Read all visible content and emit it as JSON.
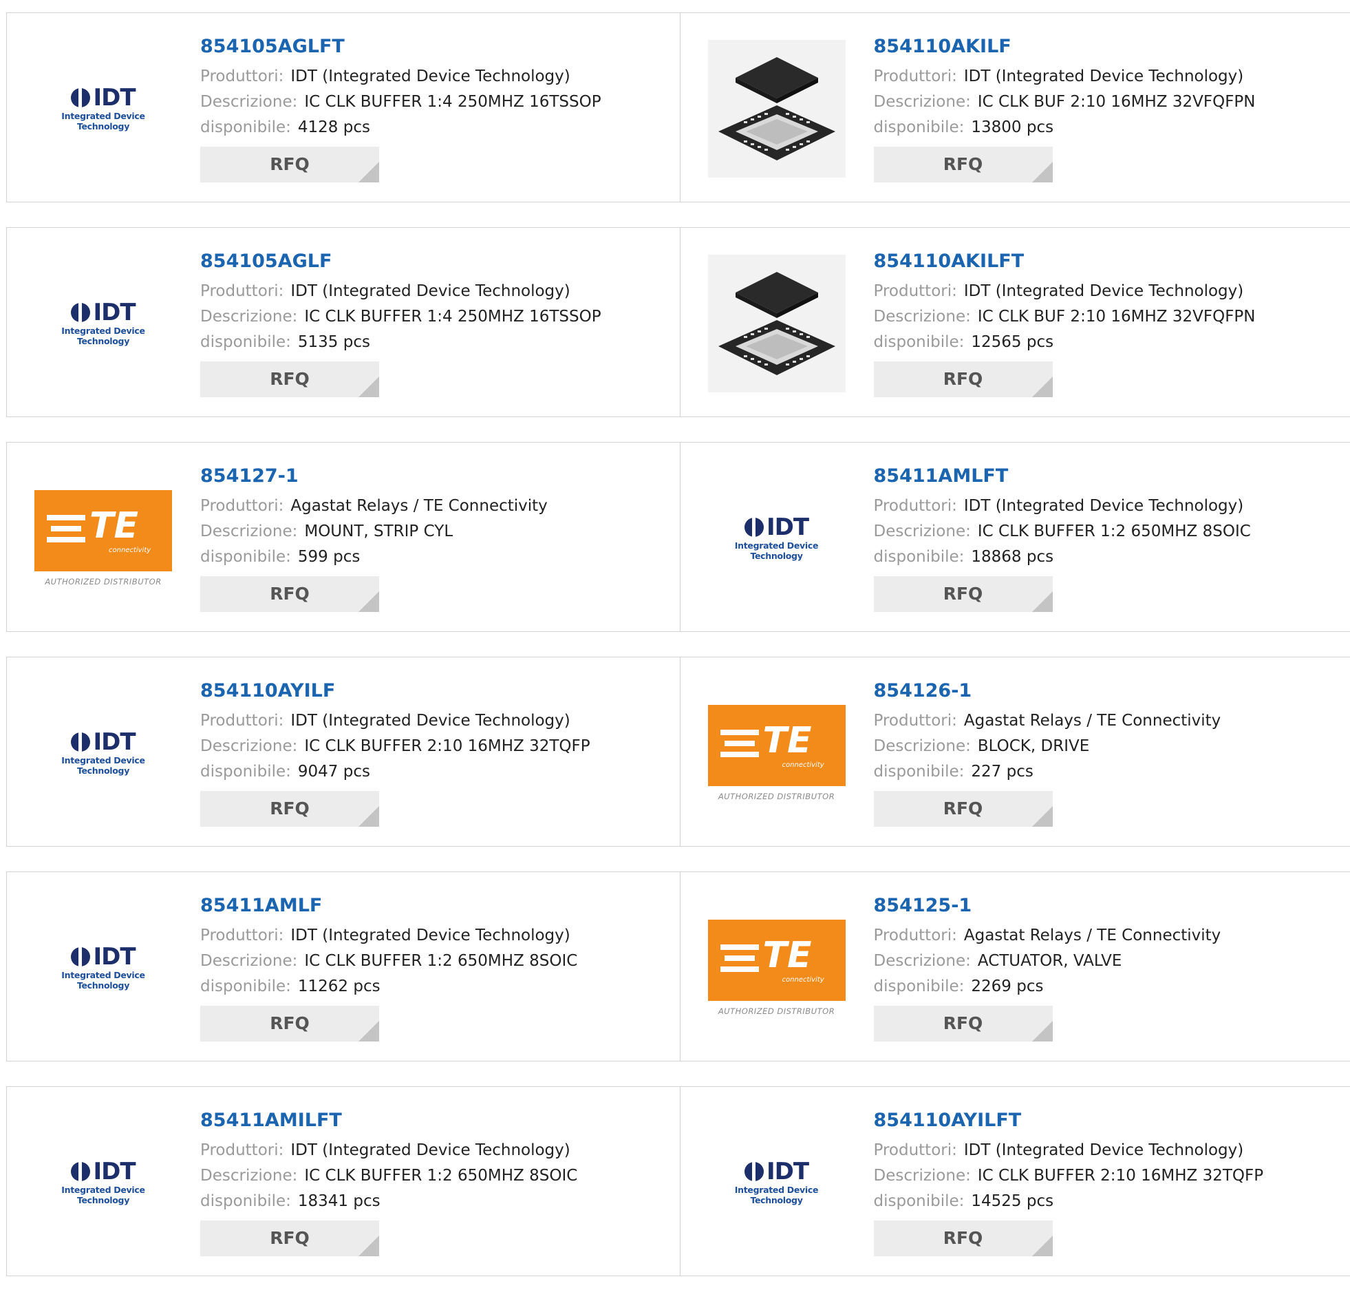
{
  "labels": {
    "manufacturer": "Produttori:",
    "description": "Descrizione:",
    "available": "disponibile:",
    "rfq": "RFQ"
  },
  "logos": {
    "idt_word": "IDT",
    "idt_tagline": "Integrated Device Technology",
    "te_word": "TE",
    "te_sub": "connectivity",
    "te_auth": "AUTHORIZED DISTRIBUTOR"
  },
  "colors": {
    "link": "#1a64b0",
    "te_orange": "#f28b1a",
    "idt_navy": "#1d2f6a"
  },
  "products": [
    {
      "part": "854105AGLFT",
      "manufacturer": "IDT (Integrated Device Technology)",
      "description": "IC CLK BUFFER 1:4 250MHZ 16TSSOP",
      "stock": "4128 pcs",
      "image": "idt-logo"
    },
    {
      "part": "854110AKILF",
      "manufacturer": "IDT (Integrated Device Technology)",
      "description": "IC CLK BUF 2:10 16MHZ 32VFQFPN",
      "stock": "13800 pcs",
      "image": "chip-photo"
    },
    {
      "part": "854105AGLF",
      "manufacturer": "IDT (Integrated Device Technology)",
      "description": "IC CLK BUFFER 1:4 250MHZ 16TSSOP",
      "stock": "5135 pcs",
      "image": "idt-logo"
    },
    {
      "part": "854110AKILFT",
      "manufacturer": "IDT (Integrated Device Technology)",
      "description": "IC CLK BUF 2:10 16MHZ 32VFQFPN",
      "stock": "12565 pcs",
      "image": "chip-photo"
    },
    {
      "part": "854127-1",
      "manufacturer": "Agastat Relays / TE Connectivity",
      "description": "MOUNT, STRIP CYL",
      "stock": "599 pcs",
      "image": "te-logo"
    },
    {
      "part": "85411AMLFT",
      "manufacturer": "IDT (Integrated Device Technology)",
      "description": "IC CLK BUFFER 1:2 650MHZ 8SOIC",
      "stock": "18868 pcs",
      "image": "idt-logo"
    },
    {
      "part": "854110AYILF",
      "manufacturer": "IDT (Integrated Device Technology)",
      "description": "IC CLK BUFFER 2:10 16MHZ 32TQFP",
      "stock": "9047 pcs",
      "image": "idt-logo"
    },
    {
      "part": "854126-1",
      "manufacturer": "Agastat Relays / TE Connectivity",
      "description": "BLOCK, DRIVE",
      "stock": "227 pcs",
      "image": "te-logo"
    },
    {
      "part": "85411AMLF",
      "manufacturer": "IDT (Integrated Device Technology)",
      "description": "IC CLK BUFFER 1:2 650MHZ 8SOIC",
      "stock": "11262 pcs",
      "image": "idt-logo"
    },
    {
      "part": "854125-1",
      "manufacturer": "Agastat Relays / TE Connectivity",
      "description": "ACTUATOR, VALVE",
      "stock": "2269 pcs",
      "image": "te-logo"
    },
    {
      "part": "85411AMILFT",
      "manufacturer": "IDT (Integrated Device Technology)",
      "description": "IC CLK BUFFER 1:2 650MHZ 8SOIC",
      "stock": "18341 pcs",
      "image": "idt-logo"
    },
    {
      "part": "854110AYILFT",
      "manufacturer": "IDT (Integrated Device Technology)",
      "description": "IC CLK BUFFER 2:10 16MHZ 32TQFP",
      "stock": "14525 pcs",
      "image": "idt-logo"
    }
  ]
}
